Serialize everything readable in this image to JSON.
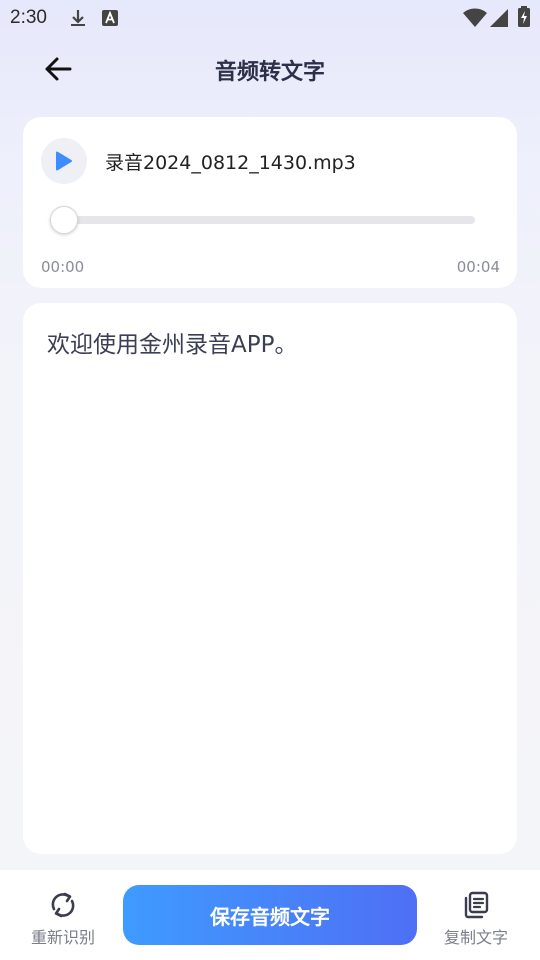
{
  "status_bar": {
    "time": "2:30"
  },
  "header": {
    "title": "音频转文字"
  },
  "player": {
    "file_name": "录音2024_0812_1430.mp3",
    "current_time": "00:00",
    "duration": "00:04",
    "progress": 0
  },
  "transcript": {
    "text": "欢迎使用金州录音APP。"
  },
  "bottom_bar": {
    "re_recognize_label": "重新识别",
    "save_label": "保存音频文字",
    "copy_label": "复制文字"
  },
  "colors": {
    "accent": "#3f8cff",
    "button_gradient_start": "#3f9bff",
    "button_gradient_end": "#4f6ff5"
  }
}
